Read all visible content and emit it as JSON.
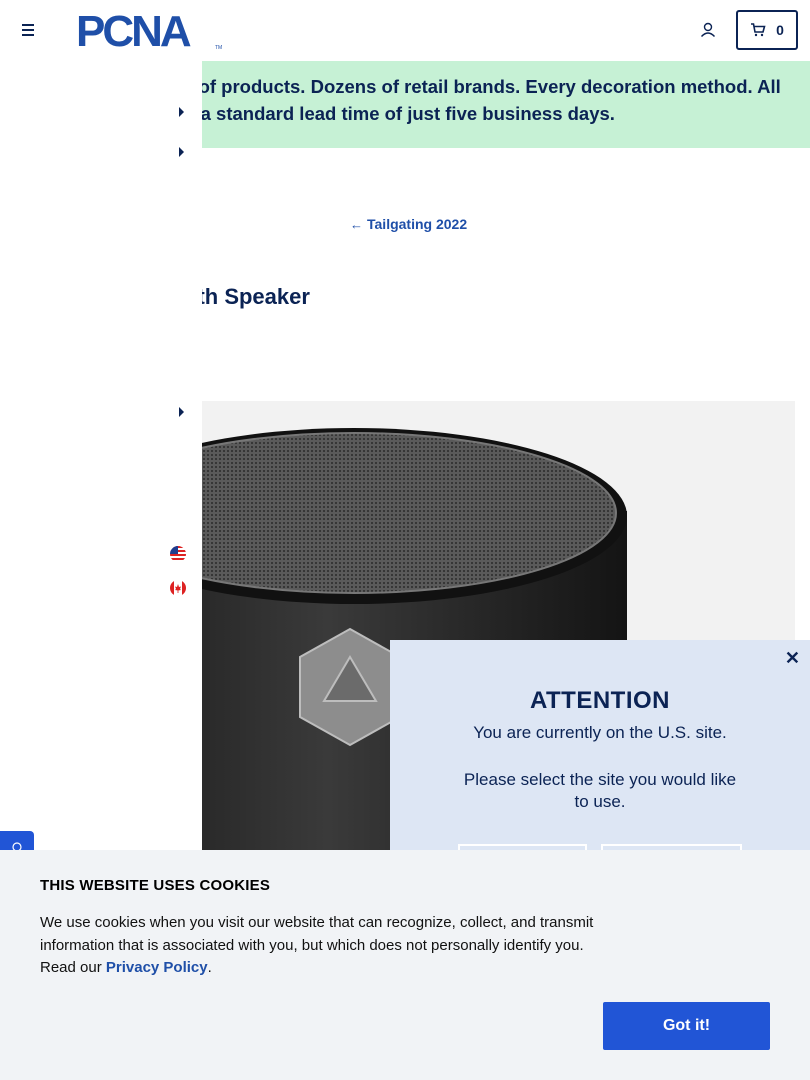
{
  "header": {
    "logo_text": "PCNA",
    "logo_tm": "TM",
    "cart_count": "0"
  },
  "promo": {
    "line1": "ls of products. Dozens of retail brands. Every decoration method. All",
    "line2": "th a standard lead time of just five business days."
  },
  "breadcrumb": {
    "back_label": "Tailgating 2022"
  },
  "product": {
    "title_partial": "oth Speaker"
  },
  "modal": {
    "close": "✕",
    "title": "ATTENTION",
    "text1": "You are currently on the U.S. site.",
    "text2": "Please select the site you would like to use."
  },
  "cookie": {
    "title": "THIS WEBSITE USES COOKIES",
    "text": "We use cookies when you visit our website that can recognize, collect, and transmit information that is associated with you, but which does not personally identify you. Read our ",
    "link": "Privacy Policy",
    "period": ".",
    "button": "Got it!"
  },
  "colors": {
    "navy": "#0b2354",
    "brand_blue": "#2155d6",
    "promo_bg": "#c6f1d5",
    "modal_bg": "#dde6f4",
    "cookie_bg": "#f1f3f6"
  }
}
